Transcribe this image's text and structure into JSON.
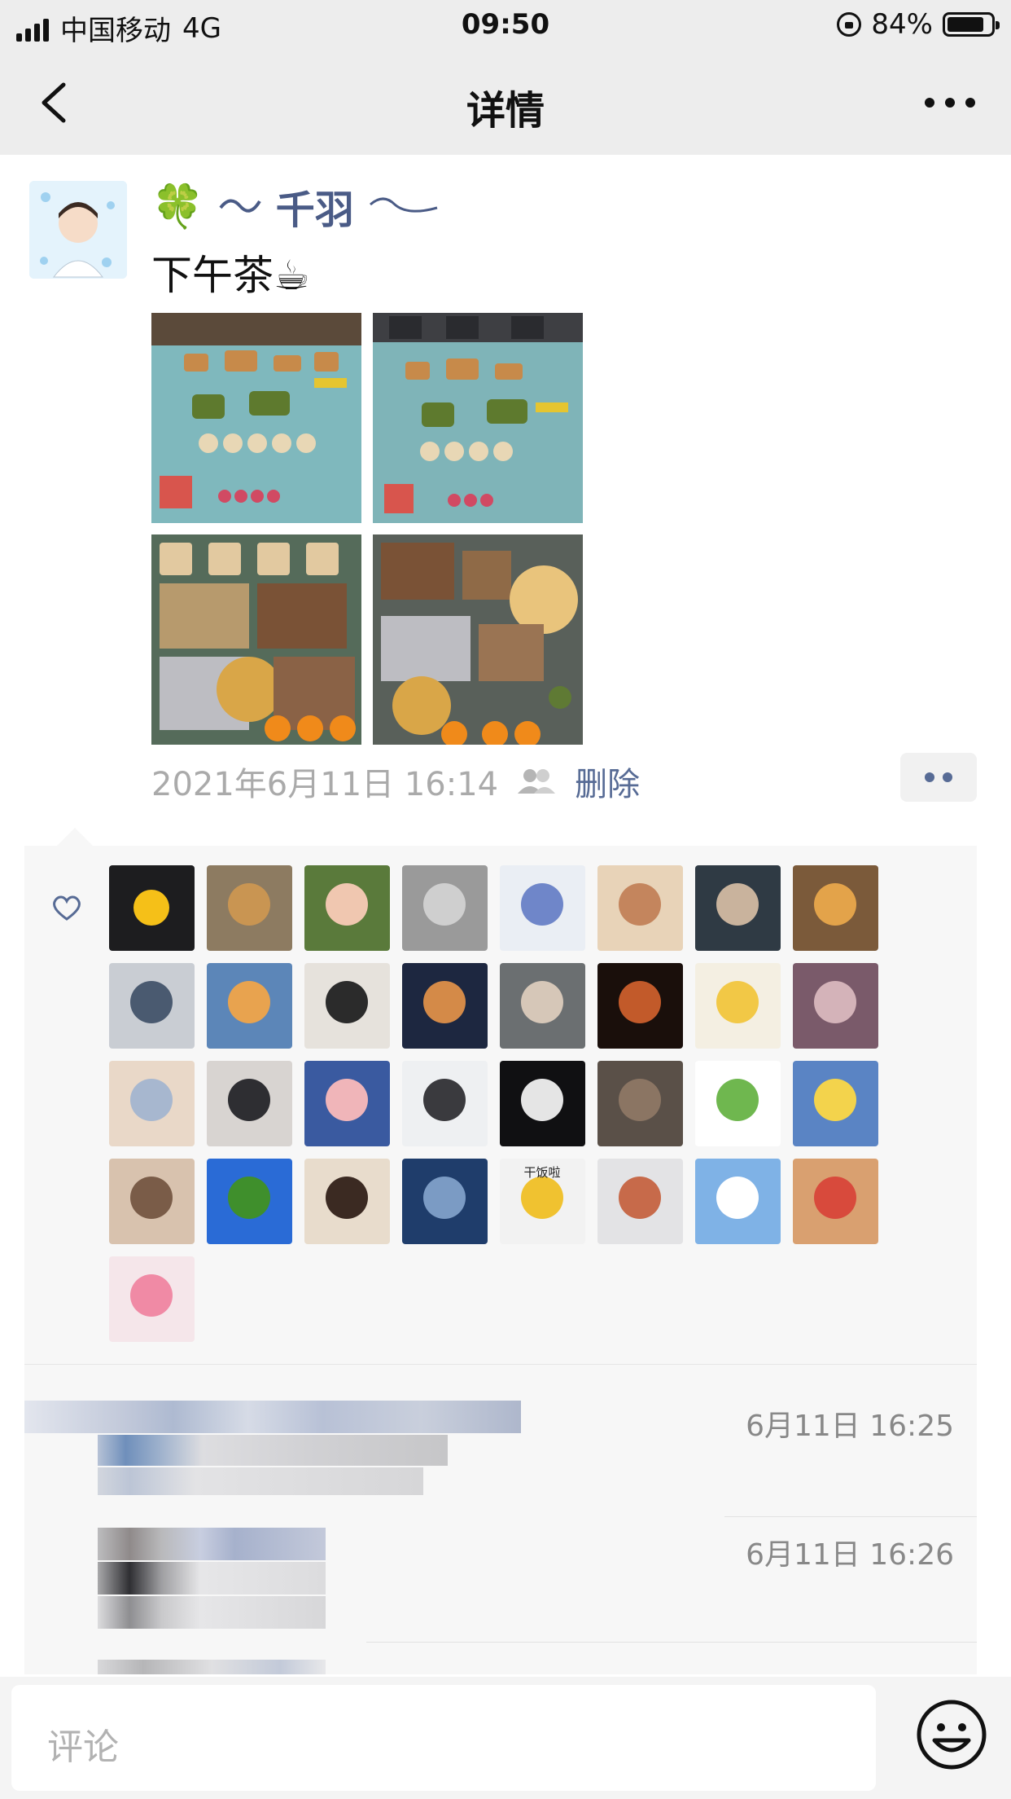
{
  "status_bar": {
    "carrier": "中国移动",
    "network": "4G",
    "time": "09:50",
    "battery_pct": "84%",
    "battery_level": 0.84
  },
  "nav": {
    "title": "详情",
    "back_icon": "chevron-left-icon",
    "more_icon": "more-dots-icon"
  },
  "post": {
    "nickname": "千羽",
    "content": "下午茶☕",
    "timestamp": "2021年6月11日 16:14",
    "delete_label": "删除",
    "photos": [
      "food-spread-1",
      "food-spread-2",
      "food-trays-1",
      "food-trays-2"
    ]
  },
  "likes": {
    "icon": "heart-icon",
    "count": 33,
    "avatars": [
      "fried-egg",
      "plush-bear",
      "woman-portrait",
      "grey-texture",
      "wall-figure",
      "crying-child",
      "woman-hair",
      "lion",
      "boy-dog",
      "shiba",
      "man-side",
      "silhouette-sunset",
      "rock",
      "shadow-hand",
      "cartoon-cat",
      "plush-toy",
      "girl-back",
      "headphones-woman",
      "girl-bunny",
      "anime-boy",
      "hands-dark",
      "street-woman",
      "watermelon-cat",
      "crayon-shin",
      "woman-closeup",
      "blue-sky",
      "man-face",
      "lake-dusk",
      "rice-pig",
      "food-table",
      "doraemon",
      "cat-santa",
      "toddler-pink"
    ],
    "sticker_text": "干饭啦"
  },
  "comments": [
    {
      "time": "6月11日 16:25"
    },
    {
      "time": "6月11日 16:26"
    }
  ],
  "comment_bar": {
    "placeholder": "评论",
    "emoji_icon": "smiley-face-icon"
  }
}
